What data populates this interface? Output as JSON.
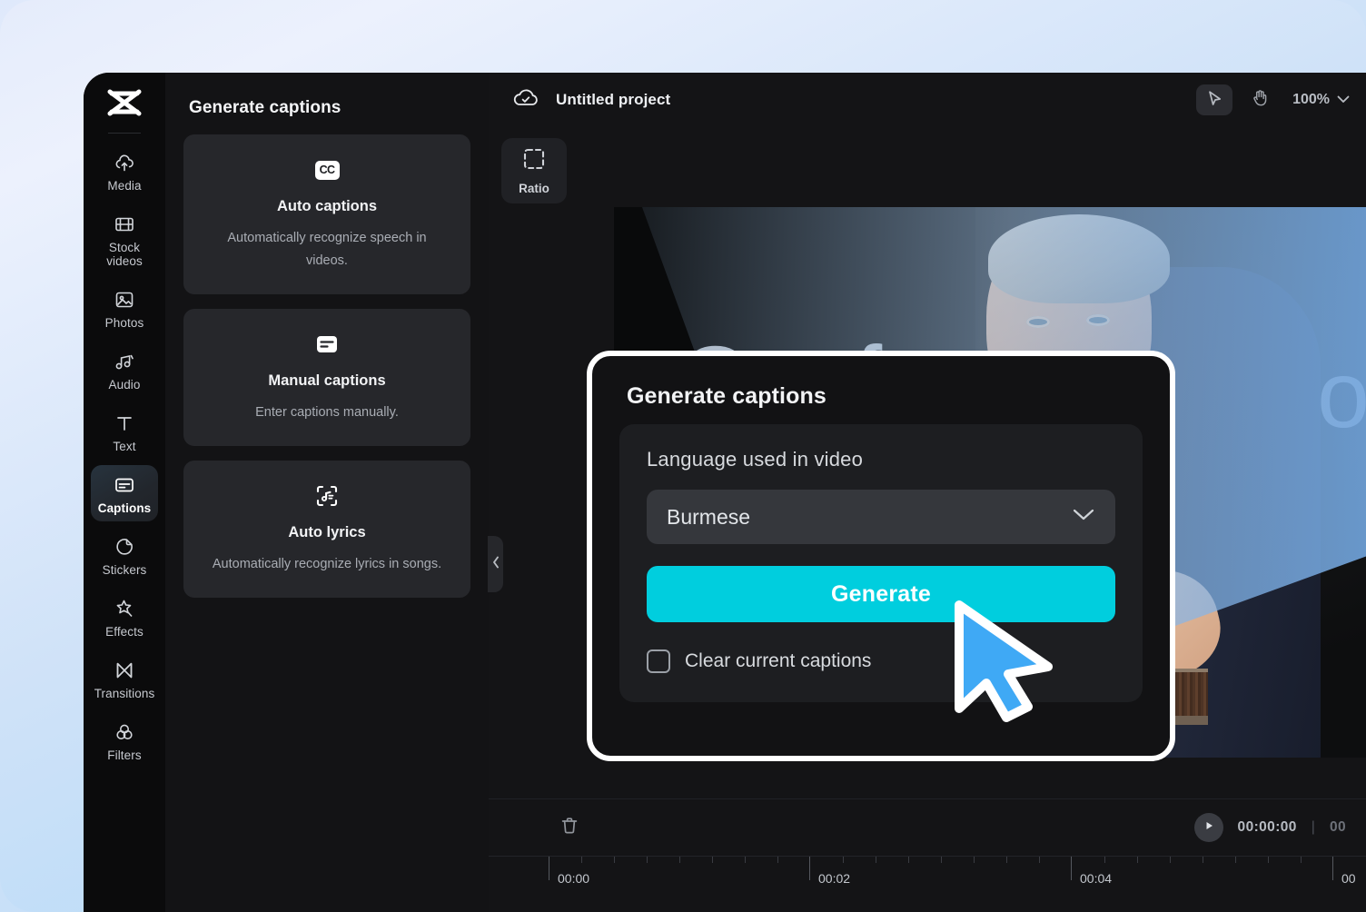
{
  "app": {
    "logo_icon": "capcut-logo-icon"
  },
  "sidebar": {
    "items": [
      {
        "label": "Media",
        "icon": "cloud-upload-icon"
      },
      {
        "label": "Stock videos",
        "icon": "film-strip-icon"
      },
      {
        "label": "Photos",
        "icon": "image-icon"
      },
      {
        "label": "Audio",
        "icon": "music-note-icon"
      },
      {
        "label": "Text",
        "icon": "text-t-icon"
      },
      {
        "label": "Captions",
        "icon": "captions-icon",
        "active": true
      },
      {
        "label": "Stickers",
        "icon": "sticker-icon"
      },
      {
        "label": "Effects",
        "icon": "sparkle-star-icon"
      },
      {
        "label": "Transitions",
        "icon": "transitions-icon"
      },
      {
        "label": "Filters",
        "icon": "filters-circles-icon"
      }
    ]
  },
  "panel": {
    "title": "Generate captions",
    "cards": [
      {
        "icon": "cc-badge-icon",
        "icon_text": "CC",
        "title": "Auto captions",
        "desc": "Automatically recognize speech in videos."
      },
      {
        "icon": "manual-captions-icon",
        "title": "Manual captions",
        "desc": "Enter captions manually."
      },
      {
        "icon": "auto-lyrics-icon",
        "title": "Auto lyrics",
        "desc": "Automatically recognize lyrics in songs."
      }
    ],
    "collapse_icon": "chevron-left-icon"
  },
  "topbar": {
    "cloud_icon": "cloud-saved-icon",
    "project_name": "Untitled project",
    "select_tool_icon": "cursor-arrow-icon",
    "hand_tool_icon": "hand-icon",
    "zoom_level": "100%",
    "zoom_chevron_icon": "chevron-down-icon"
  },
  "stage": {
    "ratio_button": {
      "label": "Ratio",
      "icon": "crop-ratio-icon"
    },
    "video_headline": "Confe",
    "video_headline_tail": "po"
  },
  "timeline": {
    "split_icon": "split-clip-icon",
    "delete_icon": "trash-delete-icon",
    "play_icon": "play-icon",
    "current_time": "00:00:00",
    "total_time": "00",
    "ruler_labels": [
      "00:00",
      "00:02",
      "00:04",
      "00"
    ]
  },
  "modal": {
    "title": "Generate captions",
    "language_label": "Language used in video",
    "language_value": "Burmese",
    "language_chevron_icon": "chevron-down-icon",
    "generate_button": "Generate",
    "checkbox_label": "Clear current captions",
    "checkbox_checked": false,
    "accent_color": "#00CEDE"
  },
  "cursor": {
    "icon": "mouse-pointer-icon",
    "color": "#3FA9F5"
  }
}
